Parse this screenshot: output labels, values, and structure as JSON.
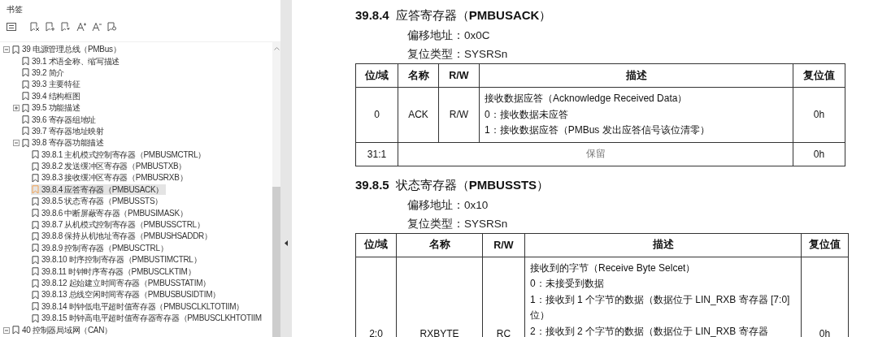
{
  "bookmarks": {
    "title": "书签",
    "toolbar": [
      {
        "kind": "list"
      },
      {
        "kind": "remove"
      },
      {
        "kind": "add"
      },
      {
        "kind": "down"
      },
      {
        "kind": "font-up"
      },
      {
        "kind": "font-down"
      },
      {
        "kind": "find"
      }
    ],
    "tree": [
      {
        "label": "39 电源管理总线（PMBus）",
        "selected": false,
        "expanded": true,
        "children": [
          {
            "label": "39.1 术语全称、缩写描述",
            "selected": false
          },
          {
            "label": "39.2 简介",
            "selected": false
          },
          {
            "label": "39.3 主要特征",
            "selected": false
          },
          {
            "label": "39.4 结构框图",
            "selected": false
          },
          {
            "label": "39.5 功能描述",
            "selected": false,
            "expanded": false
          },
          {
            "label": "39.6 寄存器组地址",
            "selected": false
          },
          {
            "label": "39.7 寄存器地址映射",
            "selected": false
          },
          {
            "label": "39.8  寄存器功能描述",
            "selected": false,
            "expanded": true,
            "children": [
              {
                "label": "39.8.1 主机模式控制寄存器（PMBUSMCTRL）",
                "selected": false
              },
              {
                "label": "39.8.2 发送缓冲区寄存器（PMBUSTXB）",
                "selected": false
              },
              {
                "label": "39.8.3 接收缓冲区寄存器（PMBUSRXB）",
                "selected": false
              },
              {
                "label": "39.8.4 应答寄存器（PMBUSACK）",
                "selected": true
              },
              {
                "label": "39.8.5 状态寄存器（PMBUSSTS）",
                "selected": false
              },
              {
                "label": "39.8.6 中断屏蔽寄存器（PMBUSIMASK）",
                "selected": false
              },
              {
                "label": "39.8.7 从机模式控制寄存器（PMBUSSCTRL）",
                "selected": false
              },
              {
                "label": "39.8.8 保持从机地址寄存器（PMBUSHSADDR）",
                "selected": false
              },
              {
                "label": "39.8.9 控制寄存器（PMBUSCTRL）",
                "selected": false
              },
              {
                "label": "39.8.10 时序控制寄存器（PMBUSTIMCTRL）",
                "selected": false
              },
              {
                "label": "39.8.11 时钟时序寄存器（PMBUSCLKTIM）",
                "selected": false
              },
              {
                "label": "39.8.12 起始建立时间寄存器（PMBUSSTATIM）",
                "selected": false
              },
              {
                "label": "39.8.13 总线空闲时间寄存器（PMBUSBUSIDTIM）",
                "selected": false
              },
              {
                "label": "39.8.14 时钟低电平超时值寄存器（PMBUSCLKLTOTIIM）",
                "selected": false
              },
              {
                "label": "39.8.15 时钟高电平超时值寄存器寄存器（PMBUSCLKHTOTIIM",
                "selected": false
              }
            ]
          }
        ]
      },
      {
        "label": "40 控制器局域网（CAN）",
        "selected": false,
        "expanded": true
      }
    ]
  },
  "document": {
    "sections": [
      {
        "number": "39.8.4",
        "title": "应答寄存器（**PMBUSACK**）",
        "offset": "偏移地址：0x0C",
        "reset_type": "复位类型：SYSRSn",
        "table": {
          "columns": [
            "位/域",
            "名称",
            "R/W",
            "描述",
            "复位值"
          ],
          "rows": [
            {
              "kind": "field",
              "bits": "0",
              "name": "ACK",
              "rw": "R/W",
              "description": [
                "接收数据应答（Acknowledge Received Data）",
                "0：接收数据未应答",
                "1：接收数据应答（PMBus 发出应答信号该位清零）"
              ],
              "reset": "0h"
            },
            {
              "kind": "reserved",
              "bits": "31:1",
              "description": [
                "保留"
              ],
              "reset": "0h"
            }
          ]
        }
      },
      {
        "number": "39.8.5",
        "title": "状态寄存器（**PMBUSSTS**）",
        "offset": "偏移地址：0x10",
        "reset_type": "复位类型：SYSRSn",
        "table": {
          "columns": [
            "位/域",
            "名称",
            "R/W",
            "描述",
            "复位值"
          ],
          "rows": [
            {
              "kind": "field",
              "bits": "2:0",
              "name": "RXBYTE",
              "rw": "RC",
              "description": [
                "接收到的字节（Receive Byte Selcet）",
                "0：未接受到数据",
                "1：接收到 1 个字节的数据（数据位于 LIN_RXB 寄存器 [7:0]位）",
                "2：接收到 2 个字节的数据（数据位于 LIN_RXB 寄存器"
              ],
              "reset": "0h"
            }
          ]
        }
      }
    ]
  }
}
